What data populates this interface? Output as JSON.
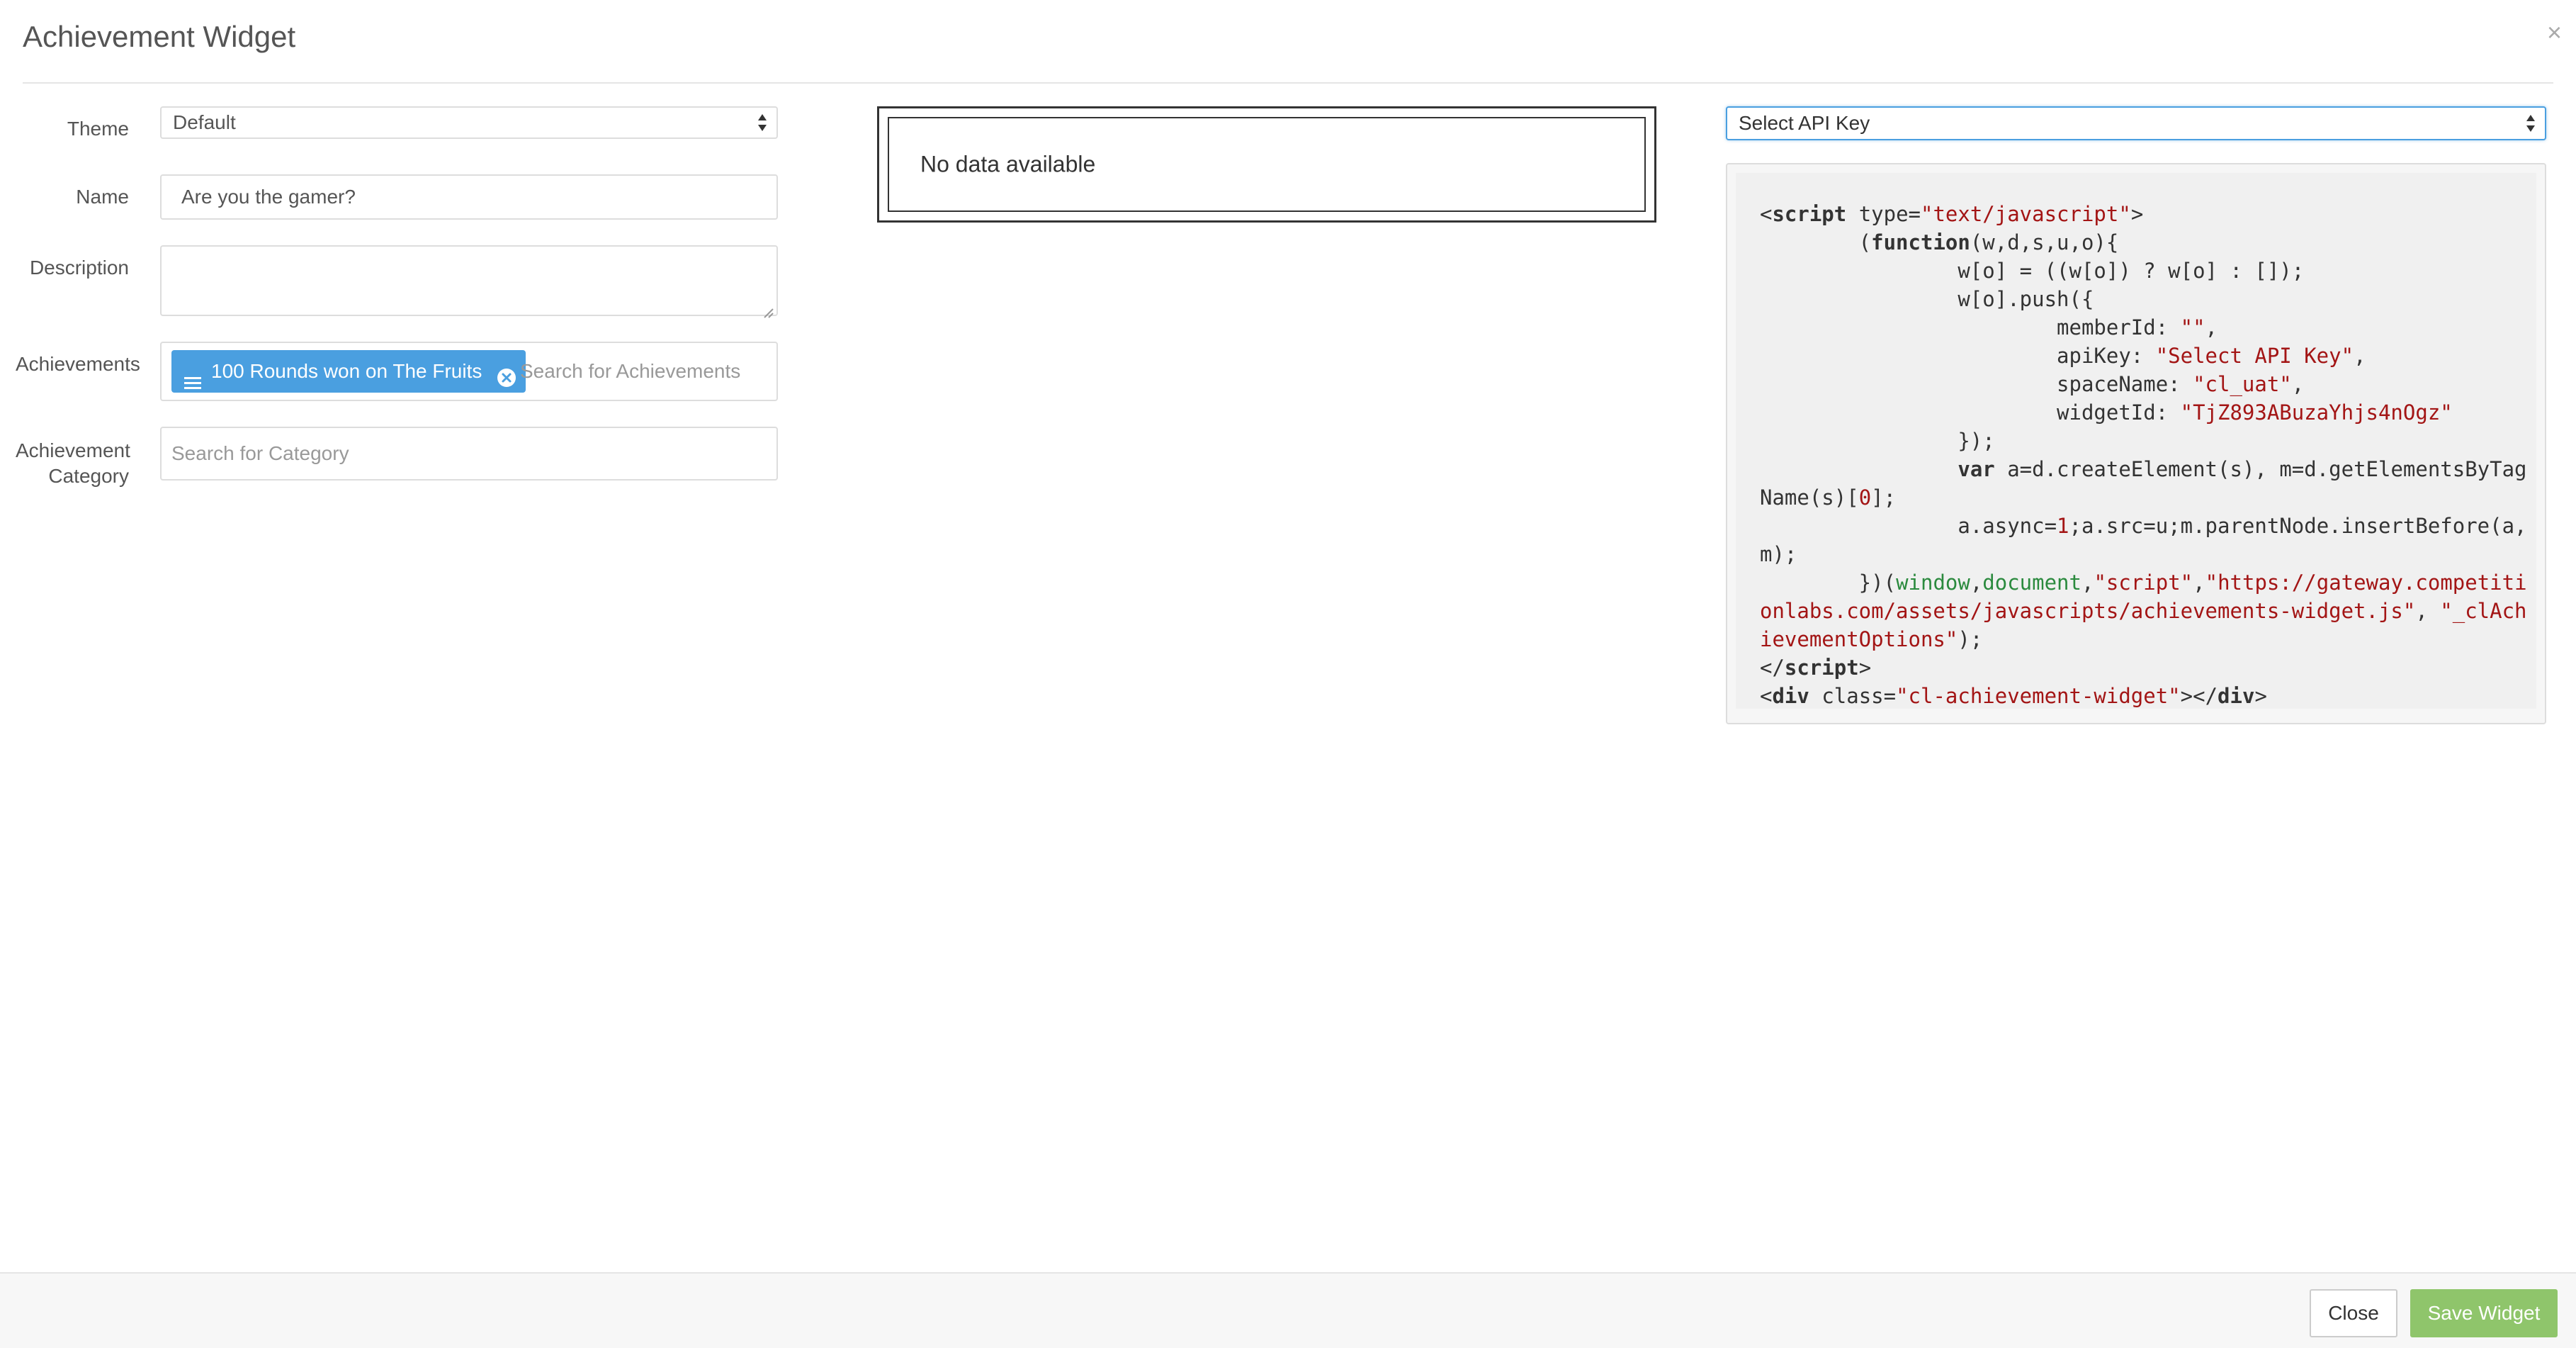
{
  "header": {
    "title": "Achievement Widget",
    "close_symbol": "×"
  },
  "form": {
    "theme": {
      "label": "Theme",
      "value": "Default"
    },
    "name": {
      "label": "Name",
      "value": "Are you the gamer?"
    },
    "description": {
      "label": "Description",
      "value": ""
    },
    "achievements": {
      "label": "Achievements",
      "tags": [
        {
          "label": "100 Rounds won on The Fruits"
        }
      ],
      "placeholder": "Search for Achievements"
    },
    "category": {
      "label_line1": "Achievement",
      "label_line2": "Category",
      "placeholder": "Search for Category"
    }
  },
  "preview": {
    "empty_text": "No data available"
  },
  "embed": {
    "api_key_select": {
      "value": "Select API Key"
    },
    "code_values": {
      "member_id": "\"\"",
      "api_key": "\"Select API Key\"",
      "space_name": "\"cl_uat\"",
      "widget_id": "\"TjZ893ABuzaYhjs4nOgz\"",
      "script_src": "\"https://gateway.competitionlabs.com/assets/javascripts/achievements-widget.js\"",
      "options_name": "\"_clAchievementOptions\"",
      "div_class": "\"cl-achievement-widget\""
    }
  },
  "footer": {
    "close_label": "Close",
    "save_label": "Save Widget"
  },
  "colors": {
    "accent": "#4a9fe0",
    "save_button": "#8fc56b",
    "code_string": "#a31515",
    "code_global": "#2b8a3e"
  }
}
